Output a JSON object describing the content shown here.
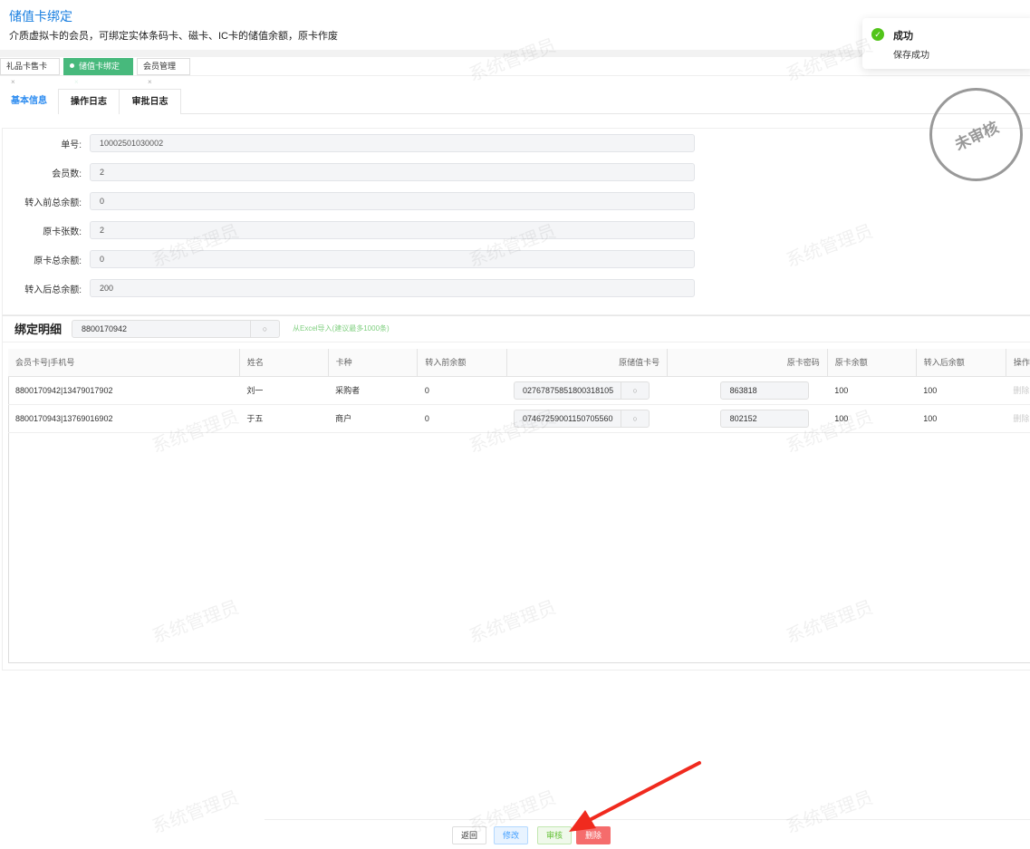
{
  "page": {
    "title": "储值卡绑定",
    "subtitle": "介质虚拟卡的会员，可绑定实体条码卡、磁卡、IC卡的储值余额，原卡作废"
  },
  "tabs": [
    {
      "label": "礼品卡售卡"
    },
    {
      "label": "储值卡绑定"
    },
    {
      "label": "会员管理"
    }
  ],
  "tab_close": "×",
  "detail_tabs": [
    {
      "label": "基本信息"
    },
    {
      "label": "操作日志"
    },
    {
      "label": "审批日志"
    }
  ],
  "form": [
    {
      "label": "单号:",
      "value": "10002501030002"
    },
    {
      "label": "会员数:",
      "value": "2"
    },
    {
      "label": "转入前总余额:",
      "value": "0"
    },
    {
      "label": "原卡张数:",
      "value": "2"
    },
    {
      "label": "原卡总余额:",
      "value": "0"
    },
    {
      "label": "转入后总余额:",
      "value": "200"
    }
  ],
  "stamp": "未审核",
  "binding": {
    "title": "绑定明细",
    "search_value": "8800170942",
    "excel_link": "从Excel导入(建议最多1000条)"
  },
  "table": {
    "headers": [
      "会员卡号|手机号",
      "姓名",
      "卡种",
      "转入前余额",
      "原储值卡号",
      "原卡密码",
      "原卡余额",
      "转入后余额",
      "操作"
    ],
    "rows": [
      {
        "member": "8800170942|13479017902",
        "name": "刘一",
        "type": "采购者",
        "before": "0",
        "card": "02767875851800318105",
        "pwd": "863818",
        "card_bal": "100",
        "after": "100",
        "op": "删除"
      },
      {
        "member": "8800170943|13769016902",
        "name": "于五",
        "type": "商户",
        "before": "0",
        "card": "07467259001150705560",
        "pwd": "802152",
        "card_bal": "100",
        "after": "100",
        "op": "删除"
      }
    ]
  },
  "buttons": {
    "back": "返回",
    "edit": "修改",
    "audit": "审核",
    "delete": "删除"
  },
  "toast": {
    "title": "成功",
    "message": "保存成功"
  },
  "watermark": "系统管理员",
  "colors": {
    "accent": "#2d8cf0",
    "tab_active": "#47b97c",
    "audit": "#52c41a",
    "danger": "#f56c6c"
  }
}
